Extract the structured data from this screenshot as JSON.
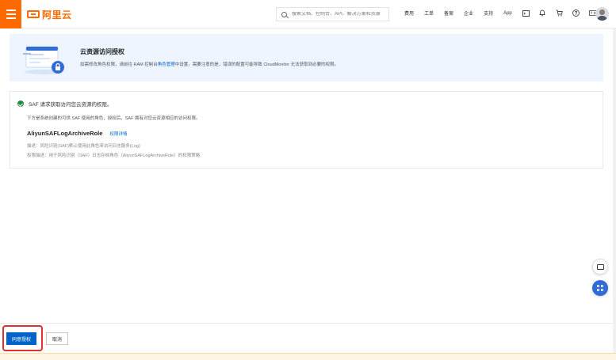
{
  "header": {
    "logo_text": "阿里云",
    "search_placeholder": "搜索文档、控制台、API、解决方案和资源",
    "nav_items": [
      "费用",
      "工单",
      "备案",
      "企业",
      "支持",
      "App"
    ]
  },
  "banner": {
    "title": "云资源访问授权",
    "desc_prefix": "如需修改角色权限，请前往 RAM 控制台",
    "desc_link": "角色管理",
    "desc_suffix": "中设置，需要注意的是，错误的配置可能导致 CloudMonitor 无法获取到必要的权限。"
  },
  "auth": {
    "status_text": "SAF 请求获取访问您云资源的权限。",
    "intro": "下方是系统创建的可供 SAF 使用的角色，授权后，SAF 拥有对您云资源相应的访问权限。",
    "role_name": "AliyunSAFLogArchiveRole",
    "role_link": "权限详情",
    "role_desc": "描述：风险识别(SAF)默认使用此角色来访问日志服务(Log)",
    "role_policy": "权限描述：用于风险识别（SAF）日志存档角色（AliyunSAFLogArchiveRole）的权限策略"
  },
  "footer": {
    "confirm_label": "同意授权",
    "cancel_label": "取消"
  },
  "colors": {
    "brand": "#ff6a00",
    "primary": "#0064c8",
    "success": "#1e8e3e",
    "highlight": "#e0302b"
  }
}
